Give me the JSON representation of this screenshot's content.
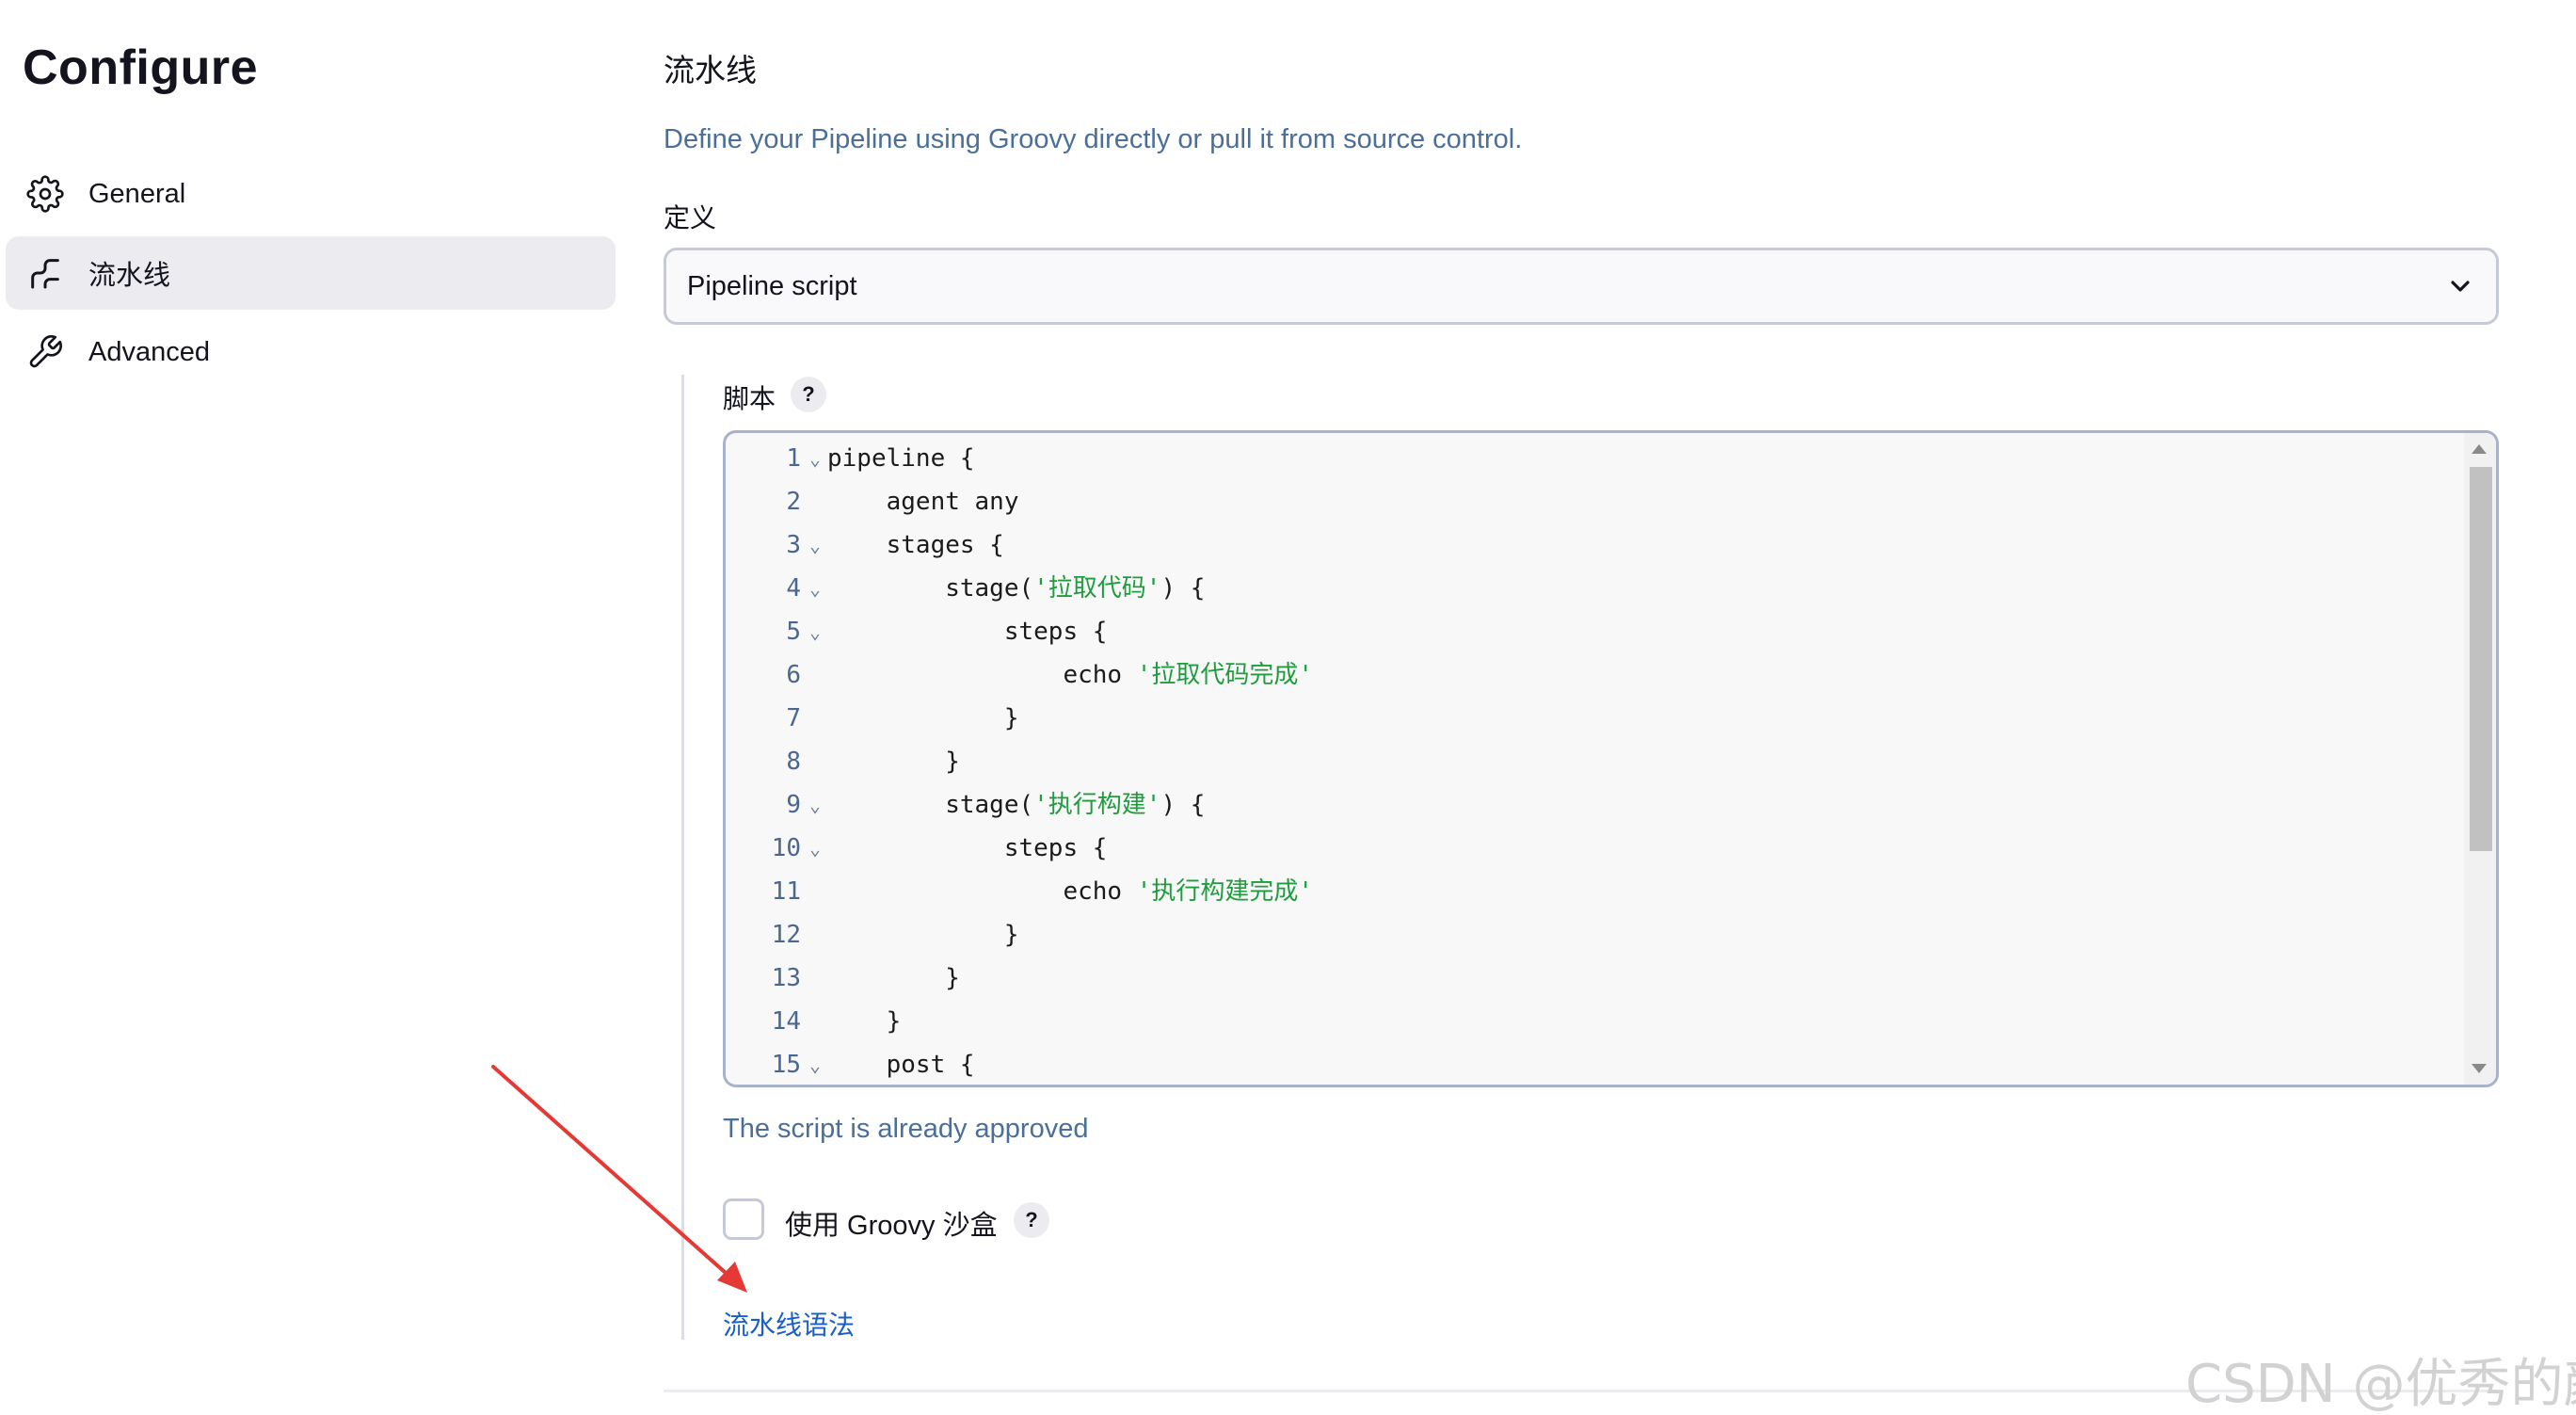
{
  "sidebar": {
    "title": "Configure",
    "items": [
      {
        "label": "General",
        "icon": "gear-icon",
        "active": false
      },
      {
        "label": "流水线",
        "icon": "pipeline-icon",
        "active": true
      },
      {
        "label": "Advanced",
        "icon": "wrench-icon",
        "active": false
      }
    ]
  },
  "main": {
    "section_title": "流水线",
    "description": "Define your Pipeline using Groovy directly or pull it from source control.",
    "definition": {
      "label": "定义",
      "selected": "Pipeline script"
    },
    "script": {
      "label": "脚本",
      "help": "?",
      "lines": [
        {
          "n": "1",
          "fold": true,
          "code": "pipeline {"
        },
        {
          "n": "2",
          "fold": false,
          "code": "    agent any"
        },
        {
          "n": "3",
          "fold": true,
          "code": "    stages {"
        },
        {
          "n": "4",
          "fold": true,
          "code": "        stage(",
          "str": "'拉取代码'",
          "tail": ") {"
        },
        {
          "n": "5",
          "fold": true,
          "code": "            steps {"
        },
        {
          "n": "6",
          "fold": false,
          "code": "                echo ",
          "str": "'拉取代码完成'",
          "tail": ""
        },
        {
          "n": "7",
          "fold": false,
          "code": "            }"
        },
        {
          "n": "8",
          "fold": false,
          "code": "        }"
        },
        {
          "n": "9",
          "fold": true,
          "code": "        stage(",
          "str": "'执行构建'",
          "tail": ") {"
        },
        {
          "n": "10",
          "fold": true,
          "code": "            steps {"
        },
        {
          "n": "11",
          "fold": false,
          "code": "                echo ",
          "str": "'执行构建完成'",
          "tail": ""
        },
        {
          "n": "12",
          "fold": false,
          "code": "            }"
        },
        {
          "n": "13",
          "fold": false,
          "code": "        }"
        },
        {
          "n": "14",
          "fold": false,
          "code": "    }"
        },
        {
          "n": "15",
          "fold": true,
          "code": "    post {"
        }
      ]
    },
    "approved_text": "The script is already approved",
    "sandbox": {
      "label": "使用 Groovy 沙盒",
      "checked": false,
      "help": "?"
    },
    "syntax_link": "流水线语法"
  },
  "watermark": "CSDN @优秀的颜",
  "colors": {
    "accent_link": "#1a5fc7",
    "muted_text": "#4b6f99",
    "string_green": "#1f9d3e",
    "arrow_red": "#e53935",
    "active_nav_bg": "#ececf0"
  }
}
